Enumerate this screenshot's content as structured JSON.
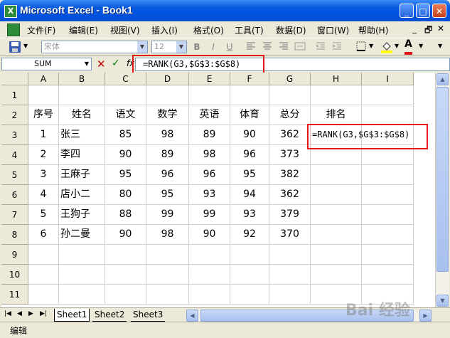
{
  "window": {
    "title": "Microsoft Excel - Book1",
    "minimize": "_",
    "maximize": "□",
    "close": "✕"
  },
  "menu": {
    "items": [
      "文件(F)",
      "编辑(E)",
      "视图(V)",
      "插入(I)",
      "格式(O)",
      "工具(T)",
      "数据(D)",
      "窗口(W)",
      "帮助(H)"
    ],
    "win_min": "_",
    "win_restore": "🗗",
    "win_close": "✕"
  },
  "toolbar": {
    "font_name": "宋体",
    "font_size": "12",
    "bold": "B",
    "italic": "I",
    "underline": "U",
    "font_color_letter": "A"
  },
  "formula_bar": {
    "name_box": "SUM",
    "cancel": "✕",
    "ok": "✓",
    "fx": "fx",
    "formula": "=RANK(G3,$G$3:$G$8)"
  },
  "sheet": {
    "columns": [
      "A",
      "B",
      "C",
      "D",
      "E",
      "F",
      "G",
      "H",
      "I"
    ],
    "rows": [
      "1",
      "2",
      "3",
      "4",
      "5",
      "6",
      "7",
      "8",
      "9",
      "10",
      "11"
    ],
    "header_row": [
      "序号",
      "姓名",
      "语文",
      "数学",
      "英语",
      "体育",
      "总分",
      "排名"
    ],
    "data_rows": [
      [
        "1",
        "张三",
        "85",
        "98",
        "89",
        "90",
        "362",
        "=RANK(G3,$G$3:$G$8)"
      ],
      [
        "2",
        "李四",
        "90",
        "89",
        "98",
        "96",
        "373",
        ""
      ],
      [
        "3",
        "王麻子",
        "95",
        "96",
        "96",
        "95",
        "382",
        ""
      ],
      [
        "4",
        "店小二",
        "80",
        "95",
        "93",
        "94",
        "362",
        ""
      ],
      [
        "5",
        "王狗子",
        "88",
        "99",
        "99",
        "93",
        "379",
        ""
      ],
      [
        "6",
        "孙二曼",
        "90",
        "98",
        "90",
        "92",
        "370",
        ""
      ]
    ]
  },
  "tabs": [
    "Sheet1",
    "Sheet2",
    "Sheet3"
  ],
  "status": "编辑",
  "watermark": "Bai 经验",
  "colors": {
    "title_blue": "#0054E3",
    "highlight_red": "#E01818",
    "cancel_red": "#C00000",
    "ok_green": "#008000"
  }
}
